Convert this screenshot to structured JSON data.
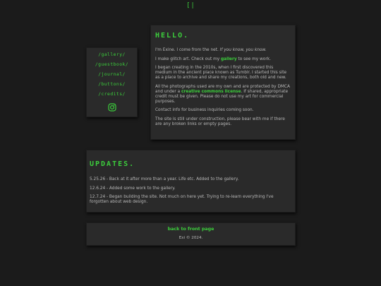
{
  "header": {
    "logo": "[|"
  },
  "nav": {
    "links": [
      "/gallery/",
      "/guestbook/",
      "/journal/",
      "/buttons/",
      "/credits/"
    ],
    "social_icon": "instagram-icon"
  },
  "hello": {
    "title": "HELLO.",
    "p1_text": "I'm Exine. I come from the net. ",
    "p1_italic": "If you know, you know.",
    "p2_before": "I make glitch art. Check out my ",
    "p2_link": "gallery",
    "p2_after": " to see my work.",
    "p3": "I began creating in the 2010s, when I first discovered this medium in the ancient place known as Tumblr. I started this site as a place to archive and share my creations, both old and new.",
    "p4_before": "All the photographs used are my own and are protected by DMCA and under a ",
    "p4_link": "creative commons license",
    "p4_after": ". If shared, appropriate credit must be given. Please do not use my art for commercial purposes.",
    "p5": "Contact info for business inquiries coming soon.",
    "p6": "The site is still under construction, please bear with me if there are any broken links or empty pages."
  },
  "updates": {
    "title": "UPDATES.",
    "items": [
      "5.25.26 - Back at it after more than a year. Life etc. Added to the gallery.",
      "12.6.24 - Added some work to the gallery.",
      "12.7.24 - Began building the site. Not much on here yet. Trying to re-learn everything I've forgotten about web design."
    ]
  },
  "footer": {
    "link": "back to front page",
    "copyright": "Exi © 2024."
  },
  "colors": {
    "accent": "#3ccf3c",
    "background": "#1b1b1b",
    "panel": "#2a2a2a",
    "text": "#bdbdbd"
  }
}
